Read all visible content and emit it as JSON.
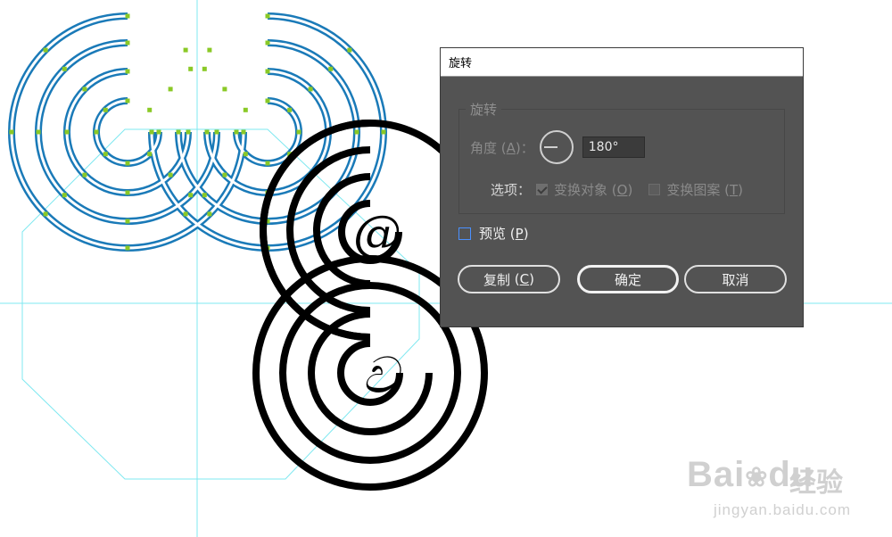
{
  "dialog": {
    "title": "旋转",
    "rotate_group": {
      "legend": "旋转",
      "angle_label": "角度",
      "angle_key": "A",
      "angle_value": "180°",
      "options_label": "选项：",
      "transform_objects_label": "变换对象",
      "transform_objects_key": "O",
      "transform_objects_checked": true,
      "transform_patterns_label": "变换图案",
      "transform_patterns_key": "T",
      "transform_patterns_checked": false
    },
    "preview_label": "预览",
    "preview_key": "P",
    "preview_checked": false,
    "copy_label": "复制",
    "copy_key": "C",
    "ok_label": "确定",
    "cancel_label": "取消"
  },
  "canvas": {
    "glyph_top": "@",
    "glyph_bottom": "ව",
    "selection_color": "#1a7ab8",
    "anchor_color": "#8ac926",
    "guide_color": "#7fe8f0",
    "artwork_color": "#000000"
  },
  "watermark": {
    "brand": "Bai",
    "brand_suffix": "du",
    "product": "经验",
    "url": "jingyan.baidu.com"
  }
}
